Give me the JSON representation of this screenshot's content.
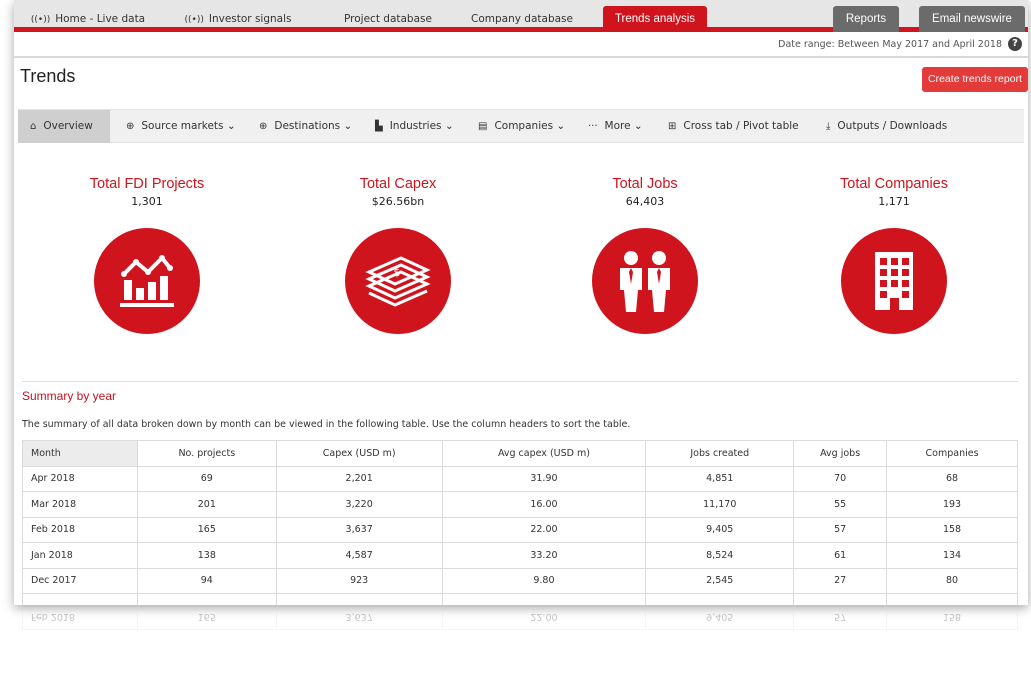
{
  "topnav": {
    "tabs": [
      {
        "label": "Home - Live data",
        "icon": "signal-icon"
      },
      {
        "label": "Investor signals",
        "icon": "signal-icon"
      },
      {
        "label": "Project database"
      },
      {
        "label": "Company database"
      },
      {
        "label": "Trends analysis",
        "active": true
      }
    ],
    "right_tabs": [
      "Reports",
      "Email newswire"
    ],
    "accent_color": "#d0141e"
  },
  "date_range": "Date range: Between May 2017 and April 2018",
  "help_glyph": "?",
  "page": {
    "title": "Trends",
    "create_button": "Create trends report"
  },
  "subnav": [
    {
      "label": "Overview",
      "icon": "home-icon",
      "active": true
    },
    {
      "label": "Source markets",
      "icon": "globe-icon",
      "dropdown": true
    },
    {
      "label": "Destinations",
      "icon": "globe-icon",
      "dropdown": true
    },
    {
      "label": "Industries",
      "icon": "bar-chart-icon",
      "dropdown": true
    },
    {
      "label": "Companies",
      "icon": "building-icon",
      "dropdown": true
    },
    {
      "label": "More",
      "icon": "ellipsis-icon",
      "dropdown": true
    },
    {
      "label": "Cross tab / Pivot table",
      "icon": "plus-square-icon"
    },
    {
      "label": "Outputs / Downloads",
      "icon": "download-icon"
    }
  ],
  "kpis": [
    {
      "title": "Total FDI Projects",
      "value": "1,301",
      "icon": "chart-icon"
    },
    {
      "title": "Total Capex",
      "value": "$26.56bn",
      "icon": "money-stack-icon"
    },
    {
      "title": "Total Jobs",
      "value": "64,403",
      "icon": "people-icon"
    },
    {
      "title": "Total Companies",
      "value": "1,171",
      "icon": "office-building-icon"
    }
  ],
  "summary": {
    "heading": "Summary by year",
    "description": "The summary of all data broken down by month can be viewed in the following table. Use the column headers to sort the table.",
    "columns": [
      "Month",
      "No. projects",
      "Capex (USD m)",
      "Avg capex (USD m)",
      "Jobs created",
      "Avg jobs",
      "Companies"
    ],
    "rows": [
      [
        "Apr 2018",
        "69",
        "2,201",
        "31.90",
        "4,851",
        "70",
        "68"
      ],
      [
        "Mar 2018",
        "201",
        "3,220",
        "16.00",
        "11,170",
        "55",
        "193"
      ],
      [
        "Feb 2018",
        "165",
        "3,637",
        "22.00",
        "9,405",
        "57",
        "158"
      ],
      [
        "Jan 2018",
        "138",
        "4,587",
        "33.20",
        "8,524",
        "61",
        "134"
      ],
      [
        "Dec 2017",
        "94",
        "923",
        "9.80",
        "2,545",
        "27",
        "80"
      ]
    ]
  }
}
